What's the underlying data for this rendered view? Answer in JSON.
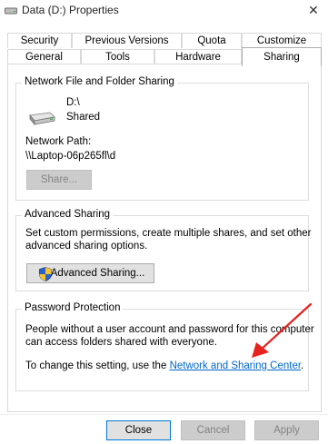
{
  "window": {
    "title": "Data (D:) Properties",
    "close_glyph": "✕"
  },
  "tabs_top": [
    "Security",
    "Previous Versions",
    "Quota",
    "Customize"
  ],
  "tabs_bottom": [
    "General",
    "Tools",
    "Hardware",
    "Sharing"
  ],
  "selected_tab": "Sharing",
  "network_sharing": {
    "group_title": "Network File and Folder Sharing",
    "drive_path": "D:\\",
    "drive_status": "Shared",
    "network_path_label": "Network Path:",
    "network_path_value": "\\\\Laptop-06p265fl\\d",
    "share_button": "Share..."
  },
  "advanced_sharing": {
    "group_title": "Advanced Sharing",
    "description_line1": "Set custom permissions, create multiple shares, and set other",
    "description_line2": "advanced sharing options.",
    "button_label": "Advanced Sharing..."
  },
  "password_protection": {
    "group_title": "Password Protection",
    "line1": "People without a user account and password for this computer",
    "line2": "can access folders shared with everyone.",
    "line3_prefix": "To change this setting, use the",
    "link_text": "Network and Sharing Center",
    "line3_suffix": "."
  },
  "footer": {
    "close": "Close",
    "cancel": "Cancel",
    "apply": "Apply"
  },
  "colors": {
    "link": "#0066cc",
    "annotation_arrow": "#e8221f",
    "focus_border": "#0078d7"
  },
  "icons": {
    "window": "drive-icon",
    "drive": "drive-icon",
    "uac_shield": "shield-icon"
  }
}
